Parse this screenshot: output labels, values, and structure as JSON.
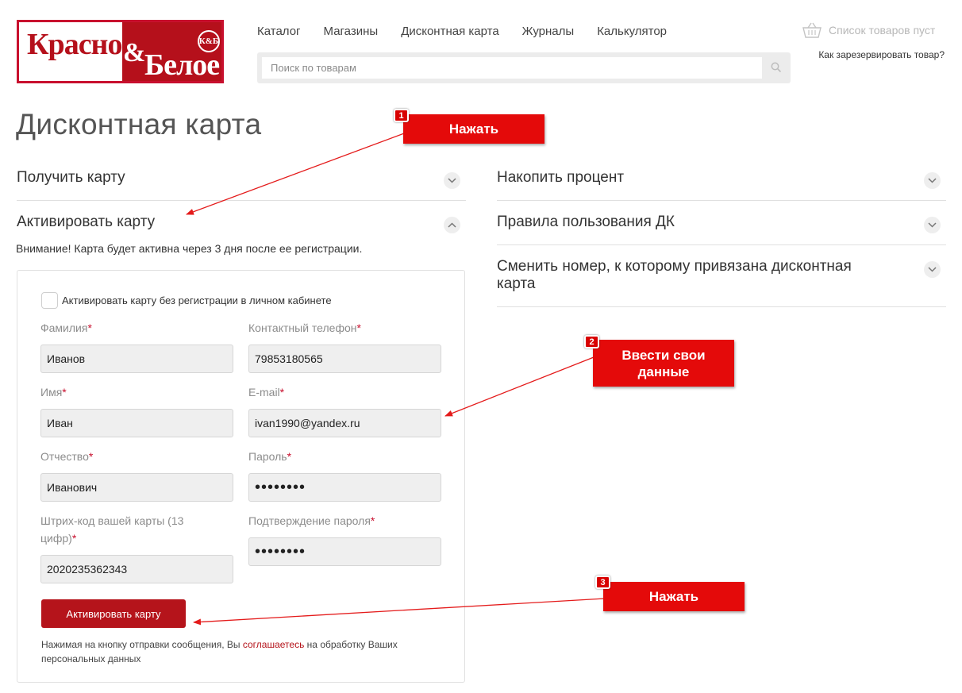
{
  "logo": {
    "word1": "Красное",
    "amp": "&",
    "word2": "Белое",
    "badge": "К&Б"
  },
  "nav": [
    "Каталог",
    "Магазины",
    "Дисконтная карта",
    "Журналы",
    "Калькулятор"
  ],
  "search": {
    "placeholder": "Поиск по товарам"
  },
  "cart": {
    "label": "Список товаров пуст"
  },
  "reserve_link": "Как зарезервировать товар?",
  "page_title": "Дисконтная карта",
  "accordion_left": {
    "get_card": "Получить карту",
    "activate_card": "Активировать карту"
  },
  "accordion_right": {
    "accumulate": "Накопить процент",
    "rules": "Правила пользования ДК",
    "change_number_1": "Сменить номер, к которому привязана дисконтная",
    "change_number_2": "карта"
  },
  "warning": "Внимание! Карта будет активна через 3 дня после ее регистрации.",
  "form": {
    "checkbox_label": "Активировать карту без регистрации в личном кабинете",
    "surname": {
      "label": "Фамилия",
      "value": "Иванов"
    },
    "phone": {
      "label": "Контактный телефон",
      "value": "79853180565"
    },
    "name": {
      "label": "Имя",
      "value": "Иван"
    },
    "email": {
      "label": "E-mail",
      "value": "ivan1990@yandex.ru"
    },
    "patronymic": {
      "label": "Отчество",
      "value": "Иванович"
    },
    "password": {
      "label": "Пароль",
      "value": "••••••••"
    },
    "barcode": {
      "label_1": "Штрих-код вашей карты (13",
      "label_2": "цифр)",
      "value": "2020235362343"
    },
    "password_confirm": {
      "label": "Подтверждение пароля",
      "value": "••••••••"
    },
    "required_mark": "*",
    "submit_label": "Активировать карту",
    "consent_prefix": "Нажимая на кнопку отправки сообщения, Вы ",
    "consent_link": "соглашаетесь",
    "consent_suffix": " на обработку Ваших персональных данных"
  },
  "annotations": [
    {
      "number": "1",
      "text": "Нажать"
    },
    {
      "number": "2",
      "text_1": "Ввести свои",
      "text_2": "данные"
    },
    {
      "number": "3",
      "text": "Нажать"
    }
  ],
  "colors": {
    "brand_red": "#b5101b",
    "callout_red": "#e40a0a",
    "required": "#c8102e"
  }
}
